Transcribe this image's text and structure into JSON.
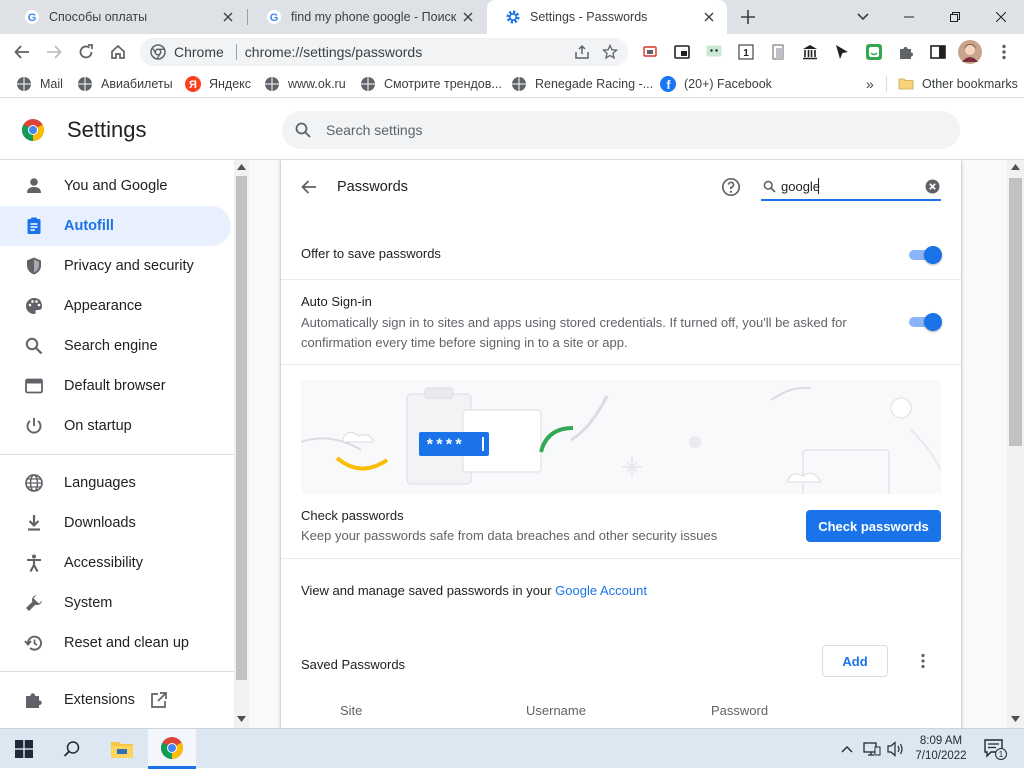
{
  "browser": {
    "tabs": [
      {
        "title": "Способы оплаты",
        "active": false
      },
      {
        "title": "find my phone google - Поиск в",
        "active": false
      },
      {
        "title": "Settings - Passwords",
        "active": true
      }
    ],
    "omnibox": {
      "label": "Chrome",
      "url": "chrome://settings/passwords"
    },
    "bookmarks": [
      "Mail",
      "Авиабилеты",
      "Яндекс",
      "www.ok.ru",
      "Смотрите трендов...",
      "Renegade Racing -...",
      "(20+) Facebook"
    ],
    "other_bookmarks": "Other bookmarks",
    "overflow": "»"
  },
  "settings": {
    "title": "Settings",
    "search_placeholder": "Search settings",
    "nav": [
      {
        "label": "You and Google",
        "icon": "person-icon"
      },
      {
        "label": "Autofill",
        "icon": "autofill-icon",
        "selected": true
      },
      {
        "label": "Privacy and security",
        "icon": "shield-icon"
      },
      {
        "label": "Appearance",
        "icon": "palette-icon"
      },
      {
        "label": "Search engine",
        "icon": "search-icon"
      },
      {
        "label": "Default browser",
        "icon": "browser-icon"
      },
      {
        "label": "On startup",
        "icon": "power-icon"
      },
      {
        "label": "Languages",
        "icon": "globe-icon"
      },
      {
        "label": "Downloads",
        "icon": "download-icon"
      },
      {
        "label": "Accessibility",
        "icon": "accessibility-icon"
      },
      {
        "label": "System",
        "icon": "wrench-icon"
      },
      {
        "label": "Reset and clean up",
        "icon": "restore-icon"
      },
      {
        "label": "Extensions",
        "icon": "puzzle-icon"
      }
    ]
  },
  "passwords": {
    "title": "Passwords",
    "search_value": "google",
    "offer_save": {
      "label": "Offer to save passwords",
      "enabled": true
    },
    "auto_signin": {
      "label": "Auto Sign-in",
      "description": "Automatically sign in to sites and apps using stored credentials. If turned off, you'll be asked for confirmation every time before signing in to a site or app.",
      "enabled": true
    },
    "illustration_text": "****",
    "check": {
      "title": "Check passwords",
      "description": "Keep your passwords safe from data breaches and other security issues",
      "button": "Check passwords"
    },
    "manage": {
      "text": "View and manage saved passwords in your ",
      "link": "Google Account"
    },
    "saved": {
      "title": "Saved Passwords",
      "add_button": "Add",
      "columns": [
        "Site",
        "Username",
        "Password"
      ]
    }
  },
  "taskbar": {
    "time": "8:09 AM",
    "date": "7/10/2022",
    "notification_count": "1"
  },
  "colors": {
    "accent": "#1a73e8",
    "toggle_track": "#8ab4f8",
    "selected_bg": "#e8f0fe",
    "link": "#1a73e8"
  }
}
